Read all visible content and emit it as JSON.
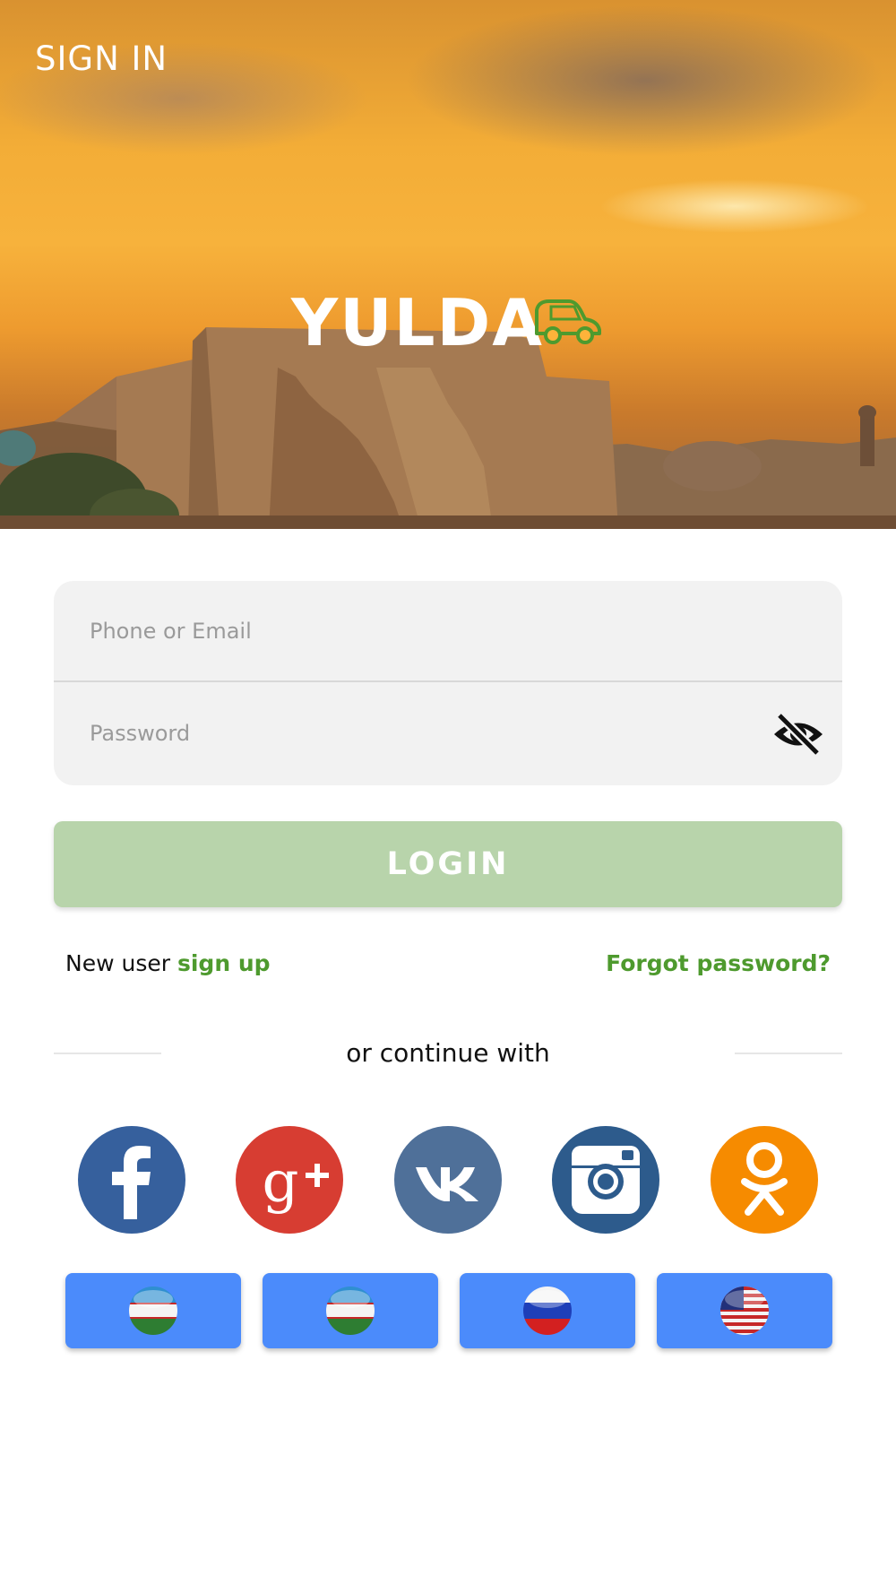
{
  "header": {
    "title": "SIGN IN"
  },
  "logo": {
    "text": "YULDA",
    "accent_color": "#4e9a2e"
  },
  "form": {
    "phone_placeholder": "Phone or Email",
    "password_placeholder": "Password",
    "login_label": "LOGIN",
    "login_color": "#b8d4ab"
  },
  "links": {
    "new_user_text": "New user",
    "sign_up": "sign up",
    "forgot_password": "Forgot password?",
    "link_color": "#4e9a2e"
  },
  "social": {
    "divider_text": "or continue with",
    "providers": [
      {
        "name": "facebook",
        "icon": "facebook-icon",
        "color": "#36609d"
      },
      {
        "name": "google-plus",
        "icon": "google-plus-icon",
        "color": "#d73d32"
      },
      {
        "name": "vk",
        "icon": "vk-icon",
        "color": "#4f7099"
      },
      {
        "name": "instagram",
        "icon": "instagram-icon",
        "color": "#2d5b8c"
      },
      {
        "name": "odnoklassniki",
        "icon": "odnoklassniki-icon",
        "color": "#f68b00"
      }
    ]
  },
  "languages": [
    {
      "flag": "uzbekistan-flag-icon"
    },
    {
      "flag": "uzbekistan-flag-icon"
    },
    {
      "flag": "russia-flag-icon"
    },
    {
      "flag": "usa-flag-icon"
    }
  ]
}
